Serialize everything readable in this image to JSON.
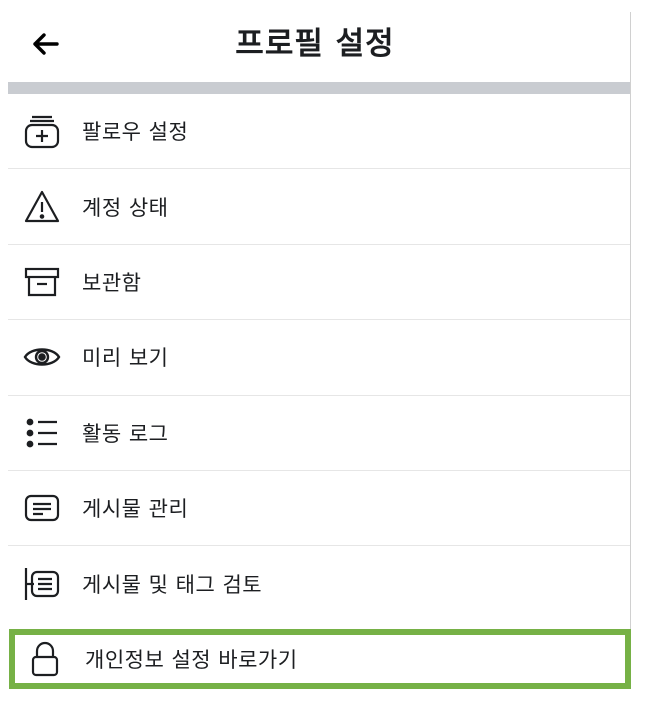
{
  "header": {
    "title": "프로필 설정",
    "back_icon": "arrow-left-icon"
  },
  "menu": {
    "items": [
      {
        "label": "팔로우 설정",
        "icon": "follow-settings-icon"
      },
      {
        "label": "계정 상태",
        "icon": "warning-icon"
      },
      {
        "label": "보관함",
        "icon": "archive-icon"
      },
      {
        "label": "미리 보기",
        "icon": "eye-icon"
      },
      {
        "label": "활동 로그",
        "icon": "list-icon"
      },
      {
        "label": "게시물 관리",
        "icon": "posts-icon"
      },
      {
        "label": "게시물 및 태그 검토",
        "icon": "review-icon"
      }
    ],
    "highlighted": {
      "label": "개인정보 설정 바로가기",
      "icon": "lock-icon",
      "border_color": "#76b146"
    }
  }
}
